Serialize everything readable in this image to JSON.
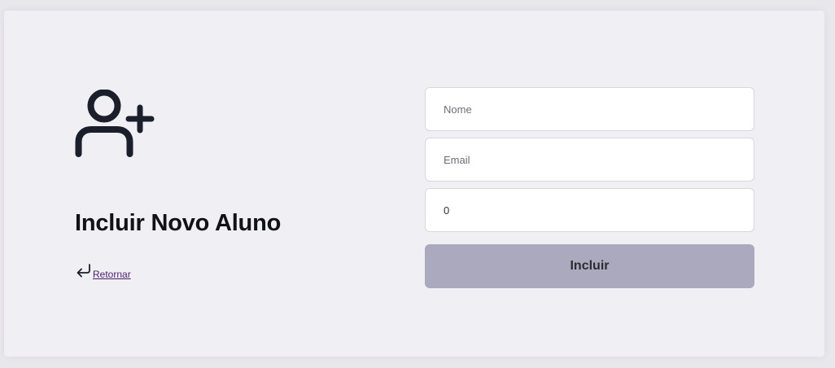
{
  "header": {
    "title": "Incluir Novo Aluno",
    "icon": "user-plus-icon"
  },
  "navigation": {
    "back_label": "Retornar",
    "back_icon": "return-arrow-icon"
  },
  "form": {
    "name_field": {
      "placeholder": "Nome",
      "value": ""
    },
    "email_field": {
      "placeholder": "Email",
      "value": ""
    },
    "number_field": {
      "value": "0"
    },
    "submit_label": "Incluir"
  },
  "colors": {
    "background": "#e8e7ec",
    "card": "#f0eff4",
    "button": "#aba9bd",
    "icon": "#1a1f2b",
    "link": "#4a1f66"
  }
}
